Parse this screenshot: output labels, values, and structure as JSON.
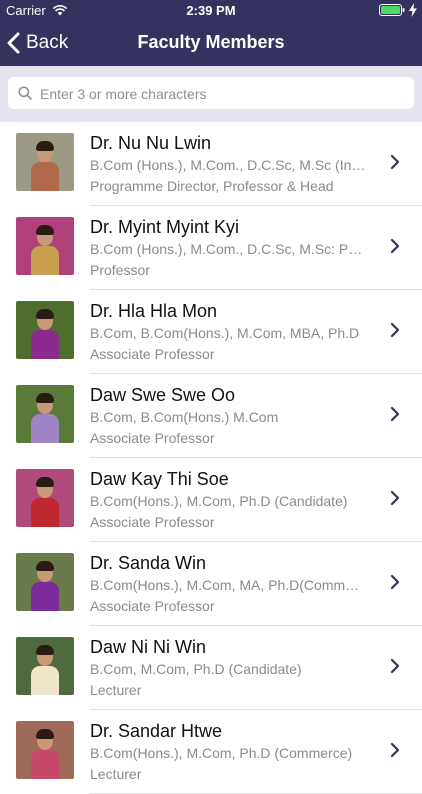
{
  "status_bar": {
    "carrier": "Carrier",
    "time": "2:39 PM",
    "icons": [
      "wifi-icon",
      "battery-icon",
      "charging-bolt-icon"
    ],
    "battery_color": "#4cd964"
  },
  "nav": {
    "back_label": "Back",
    "title": "Faculty Members",
    "bar_color": "#34335f"
  },
  "search": {
    "placeholder": "Enter 3 or more characters",
    "value": ""
  },
  "faculty": [
    {
      "name": "Dr. Nu Nu Lwin",
      "degrees": "B.Com (Hons.), M.Com., D.C.Sc, M.Sc (International Business)",
      "position": "Programme Director, Professor & Head",
      "bg": "#9c9a84",
      "outfit": "#b06a4a"
    },
    {
      "name": "Dr. Myint Myint Kyi",
      "degrees": "B.Com (Hons.), M.Com., D.C.Sc, M.Sc: Public Administration",
      "position": "Professor",
      "bg": "#b0407a",
      "outfit": "#c8a050"
    },
    {
      "name": "Dr. Hla Hla Mon",
      "degrees": "B.Com, B.Com(Hons.), M.Com, MBA, Ph.D",
      "position": "Associate Professor",
      "bg": "#4f6e2e",
      "outfit": "#8a2a8c"
    },
    {
      "name": "Daw Swe Swe Oo",
      "degrees": "B.Com, B.Com(Hons.) M.Com",
      "position": "Associate Professor",
      "bg": "#5a7a3a",
      "outfit": "#a084c4"
    },
    {
      "name": "Daw Kay Thi Soe",
      "degrees": "B.Com(Hons.), M.Com, Ph.D (Candidate)",
      "position": "Associate Professor",
      "bg": "#b04a7a",
      "outfit": "#c02830"
    },
    {
      "name": "Dr. Sanda Win",
      "degrees": "B.Com(Hons.), M.Com, MA, Ph.D(Commerce)",
      "position": "Associate Professor",
      "bg": "#6a7a4a",
      "outfit": "#7a2a9a"
    },
    {
      "name": "Daw Ni Ni Win",
      "degrees": "B.Com, M.Com, Ph.D (Candidate)",
      "position": "Lecturer",
      "bg": "#4e6a3e",
      "outfit": "#efe6cc"
    },
    {
      "name": "Dr. Sandar Htwe",
      "degrees": "B.Com(Hons.), M.Com, Ph.D (Commerce)",
      "position": "Lecturer",
      "bg": "#a06a5a",
      "outfit": "#c8486a"
    }
  ]
}
